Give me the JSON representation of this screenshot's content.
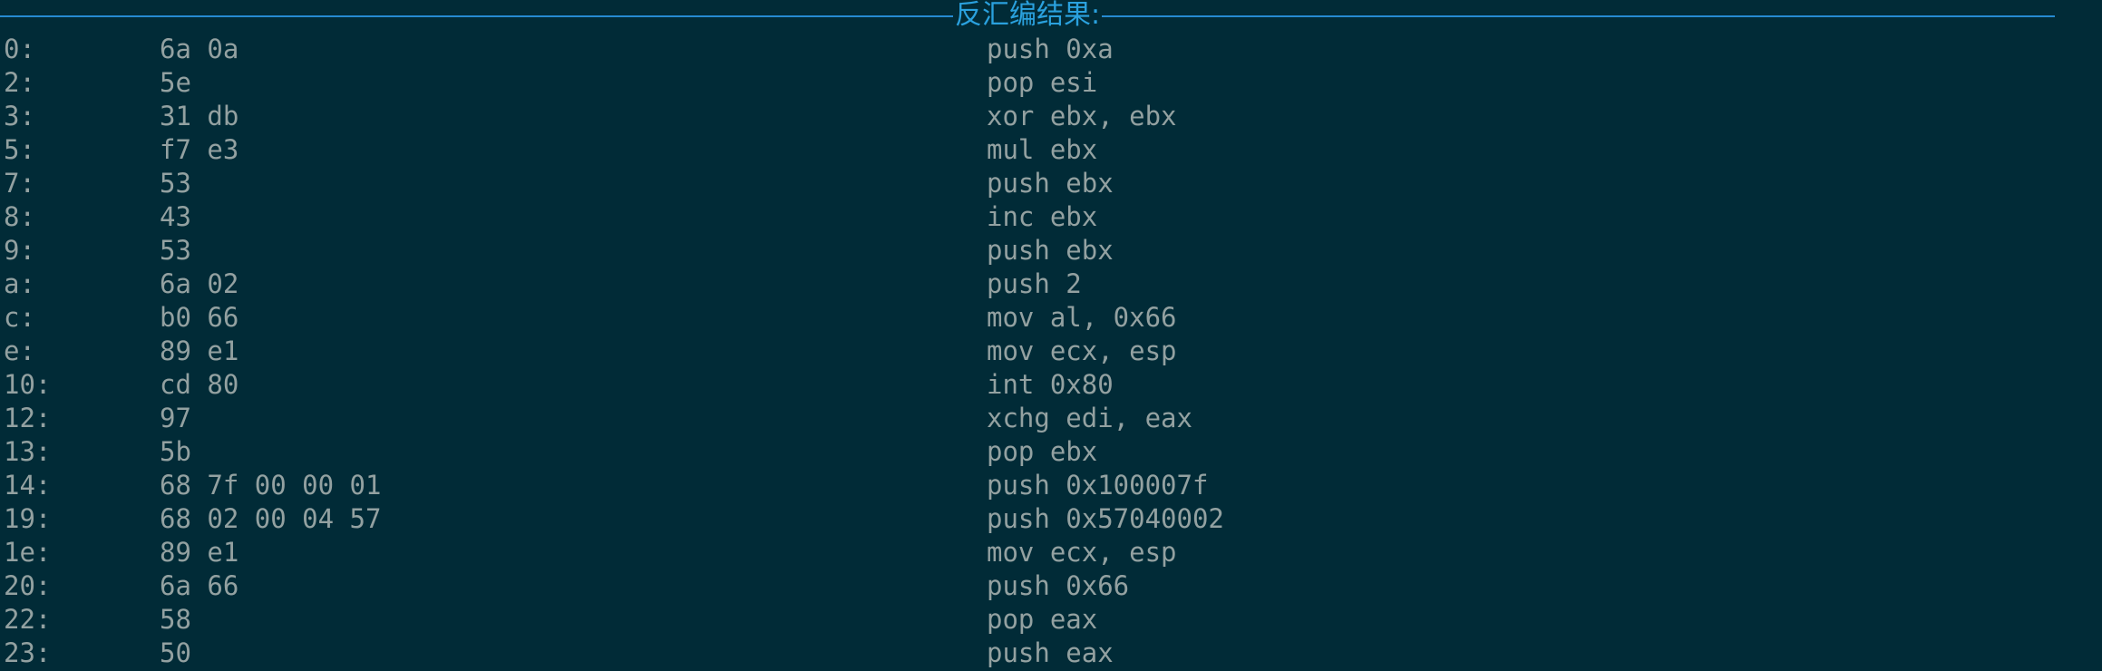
{
  "header": {
    "title": "反汇编结果:"
  },
  "rows": [
    {
      "offset": "0:",
      "bytes": "6a 0a",
      "instr": "push 0xa"
    },
    {
      "offset": "2:",
      "bytes": "5e",
      "instr": "pop esi"
    },
    {
      "offset": "3:",
      "bytes": "31 db",
      "instr": "xor ebx, ebx"
    },
    {
      "offset": "5:",
      "bytes": "f7 e3",
      "instr": "mul ebx"
    },
    {
      "offset": "7:",
      "bytes": "53",
      "instr": "push ebx"
    },
    {
      "offset": "8:",
      "bytes": "43",
      "instr": "inc ebx"
    },
    {
      "offset": "9:",
      "bytes": "53",
      "instr": "push ebx"
    },
    {
      "offset": "a:",
      "bytes": "6a 02",
      "instr": "push 2"
    },
    {
      "offset": "c:",
      "bytes": "b0 66",
      "instr": "mov al, 0x66"
    },
    {
      "offset": "e:",
      "bytes": "89 e1",
      "instr": "mov ecx, esp"
    },
    {
      "offset": "10:",
      "bytes": "cd 80",
      "instr": "int 0x80"
    },
    {
      "offset": "12:",
      "bytes": "97",
      "instr": "xchg edi, eax"
    },
    {
      "offset": "13:",
      "bytes": "5b",
      "instr": "pop ebx"
    },
    {
      "offset": "14:",
      "bytes": "68 7f 00 00 01",
      "instr": "push 0x100007f"
    },
    {
      "offset": "19:",
      "bytes": "68 02 00 04 57",
      "instr": "push 0x57040002"
    },
    {
      "offset": "1e:",
      "bytes": "89 e1",
      "instr": "mov ecx, esp"
    },
    {
      "offset": "20:",
      "bytes": "6a 66",
      "instr": "push 0x66"
    },
    {
      "offset": "22:",
      "bytes": "58",
      "instr": "pop eax"
    },
    {
      "offset": "23:",
      "bytes": "50",
      "instr": "push eax"
    }
  ],
  "colors": {
    "background": "#012b37",
    "text": "#93a1a1",
    "accent": "#268bd2"
  }
}
